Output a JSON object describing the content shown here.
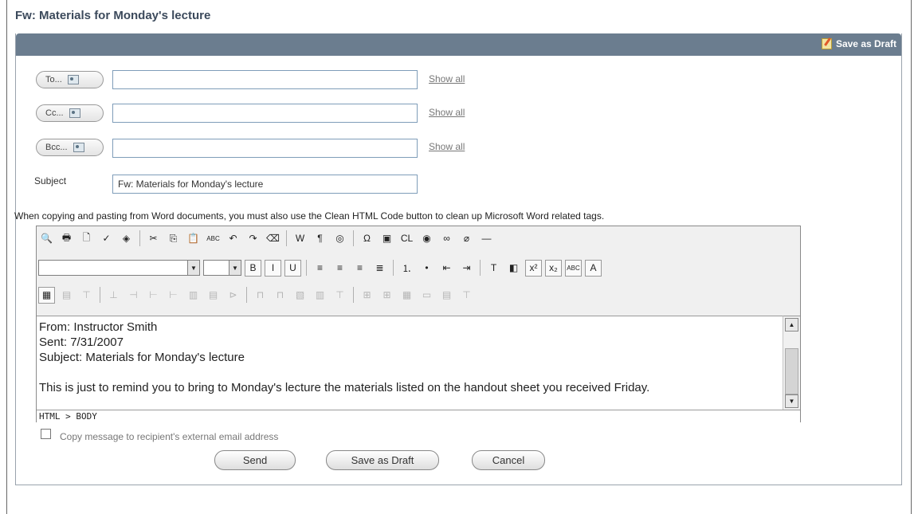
{
  "page_title": "Fw: Materials for Monday's lecture",
  "header": {
    "save_as_draft": "Save as Draft"
  },
  "recipients": [
    {
      "label": "To...",
      "value": "",
      "show_all": "Show all"
    },
    {
      "label": "Cc...",
      "value": "",
      "show_all": "Show all"
    },
    {
      "label": "Bcc...",
      "value": "",
      "show_all": "Show all"
    }
  ],
  "subject": {
    "label": "Subject",
    "value": "Fw: Materials for Monday's lecture"
  },
  "note": "When copying and pasting from Word documents, you must also use the Clean HTML Code button to clean up Microsoft Word related tags.",
  "toolbar": {
    "row1": [
      {
        "icon": "find-icon",
        "glyph": "🔍"
      },
      {
        "icon": "print-icon",
        "glyph": "🖶"
      },
      {
        "icon": "preview-icon",
        "glyph": "🗋"
      },
      {
        "icon": "spellcheck-icon",
        "glyph": "✓"
      },
      {
        "icon": "thesaurus-icon",
        "glyph": "◈"
      },
      {
        "sep": true
      },
      {
        "icon": "cut-icon",
        "glyph": "✂"
      },
      {
        "icon": "copy-icon",
        "glyph": "⎘"
      },
      {
        "icon": "paste-icon",
        "glyph": "📋"
      },
      {
        "icon": "paste-text-icon",
        "glyph": "ABC"
      },
      {
        "icon": "undo-icon",
        "glyph": "↶"
      },
      {
        "icon": "redo-icon",
        "glyph": "↷"
      },
      {
        "icon": "eraser-icon",
        "glyph": "⌫"
      },
      {
        "sep": true
      },
      {
        "icon": "paste-word-icon",
        "glyph": "W"
      },
      {
        "icon": "pilcrow-icon",
        "glyph": "¶"
      },
      {
        "icon": "clean-format-icon",
        "glyph": "◎"
      },
      {
        "sep": true
      },
      {
        "icon": "special-char-icon",
        "glyph": "Ω"
      },
      {
        "icon": "image-icon",
        "glyph": "▣"
      },
      {
        "icon": "clean-html-icon",
        "glyph": "CL"
      },
      {
        "icon": "web-icon",
        "glyph": "◉"
      },
      {
        "icon": "link-icon",
        "glyph": "∞"
      },
      {
        "icon": "unlink-icon",
        "glyph": "⌀"
      },
      {
        "icon": "horizontal-rule-icon",
        "glyph": "—"
      }
    ],
    "row2": [
      {
        "icon": "bold-icon",
        "glyph": "B"
      },
      {
        "icon": "italic-icon",
        "glyph": "I"
      },
      {
        "icon": "underline-icon",
        "glyph": "U"
      },
      {
        "sep": true
      },
      {
        "icon": "align-left-icon",
        "glyph": "≡"
      },
      {
        "icon": "align-center-icon",
        "glyph": "≡"
      },
      {
        "icon": "align-right-icon",
        "glyph": "≡"
      },
      {
        "icon": "justify-icon",
        "glyph": "≣"
      },
      {
        "sep": true
      },
      {
        "icon": "numbered-list-icon",
        "glyph": "⒈"
      },
      {
        "icon": "bullet-list-icon",
        "glyph": "•"
      },
      {
        "icon": "outdent-icon",
        "glyph": "⇤"
      },
      {
        "icon": "indent-icon",
        "glyph": "⇥"
      },
      {
        "sep": true
      },
      {
        "icon": "text-color-icon",
        "glyph": "T"
      },
      {
        "icon": "highlight-icon",
        "glyph": "◧"
      },
      {
        "icon": "superscript-icon",
        "glyph": "x²"
      },
      {
        "icon": "subscript-icon",
        "glyph": "x₂"
      },
      {
        "icon": "strikethrough-icon",
        "glyph": "ABC"
      },
      {
        "icon": "font-size-icon",
        "glyph": "A"
      }
    ],
    "row3": [
      {
        "icon": "insert-table-icon",
        "glyph": "▦",
        "dim": false
      },
      {
        "icon": "table-properties-icon",
        "glyph": "▤",
        "dim": true
      },
      {
        "icon": "insert-row-above-icon",
        "glyph": "⊤",
        "dim": true
      },
      {
        "sep": true
      },
      {
        "icon": "insert-row-below-icon",
        "glyph": "⊥",
        "dim": true
      },
      {
        "icon": "delete-row-icon",
        "glyph": "⊣",
        "dim": true
      },
      {
        "icon": "insert-col-left-icon",
        "glyph": "⊢",
        "dim": true
      },
      {
        "icon": "insert-col-right-icon",
        "glyph": "⊢",
        "dim": true
      },
      {
        "icon": "cell-properties-icon",
        "glyph": "▥",
        "dim": true
      },
      {
        "icon": "merge-cells-icon",
        "glyph": "▤",
        "dim": true
      },
      {
        "icon": "split-cell-icon",
        "glyph": "⊳",
        "dim": true
      },
      {
        "sep": true
      },
      {
        "icon": "insert-col-before-icon",
        "glyph": "⊓",
        "dim": true
      },
      {
        "icon": "insert-col-after-icon",
        "glyph": "⊓",
        "dim": true
      },
      {
        "icon": "column-properties-icon",
        "glyph": "▧",
        "dim": true
      },
      {
        "icon": "delete-col-icon",
        "glyph": "▥",
        "dim": true
      },
      {
        "icon": "split-col-icon",
        "glyph": "⊤",
        "dim": true
      },
      {
        "sep": true
      },
      {
        "icon": "merge-right-icon",
        "glyph": "⊞",
        "dim": true
      },
      {
        "icon": "merge-down-icon",
        "glyph": "⊞",
        "dim": true
      },
      {
        "icon": "split-horizontal-icon",
        "glyph": "▦",
        "dim": true
      },
      {
        "icon": "split-vertical-icon",
        "glyph": "▭",
        "dim": true
      },
      {
        "icon": "row-properties-icon",
        "glyph": "▤",
        "dim": true
      },
      {
        "icon": "delete-cell-icon",
        "glyph": "⊤",
        "dim": true
      }
    ]
  },
  "body_lines": [
    "From: Instructor Smith",
    "Sent: 7/31/2007",
    "Subject: Materials for Monday's lecture",
    "",
    "This is just to remind you to bring to Monday's lecture the materials listed on the handout sheet you received Friday."
  ],
  "status_path": "HTML > BODY",
  "copy_external": {
    "label": "Copy message to recipient's external email address",
    "checked": false
  },
  "buttons": {
    "send": "Send",
    "save_draft": "Save as Draft",
    "cancel": "Cancel"
  }
}
